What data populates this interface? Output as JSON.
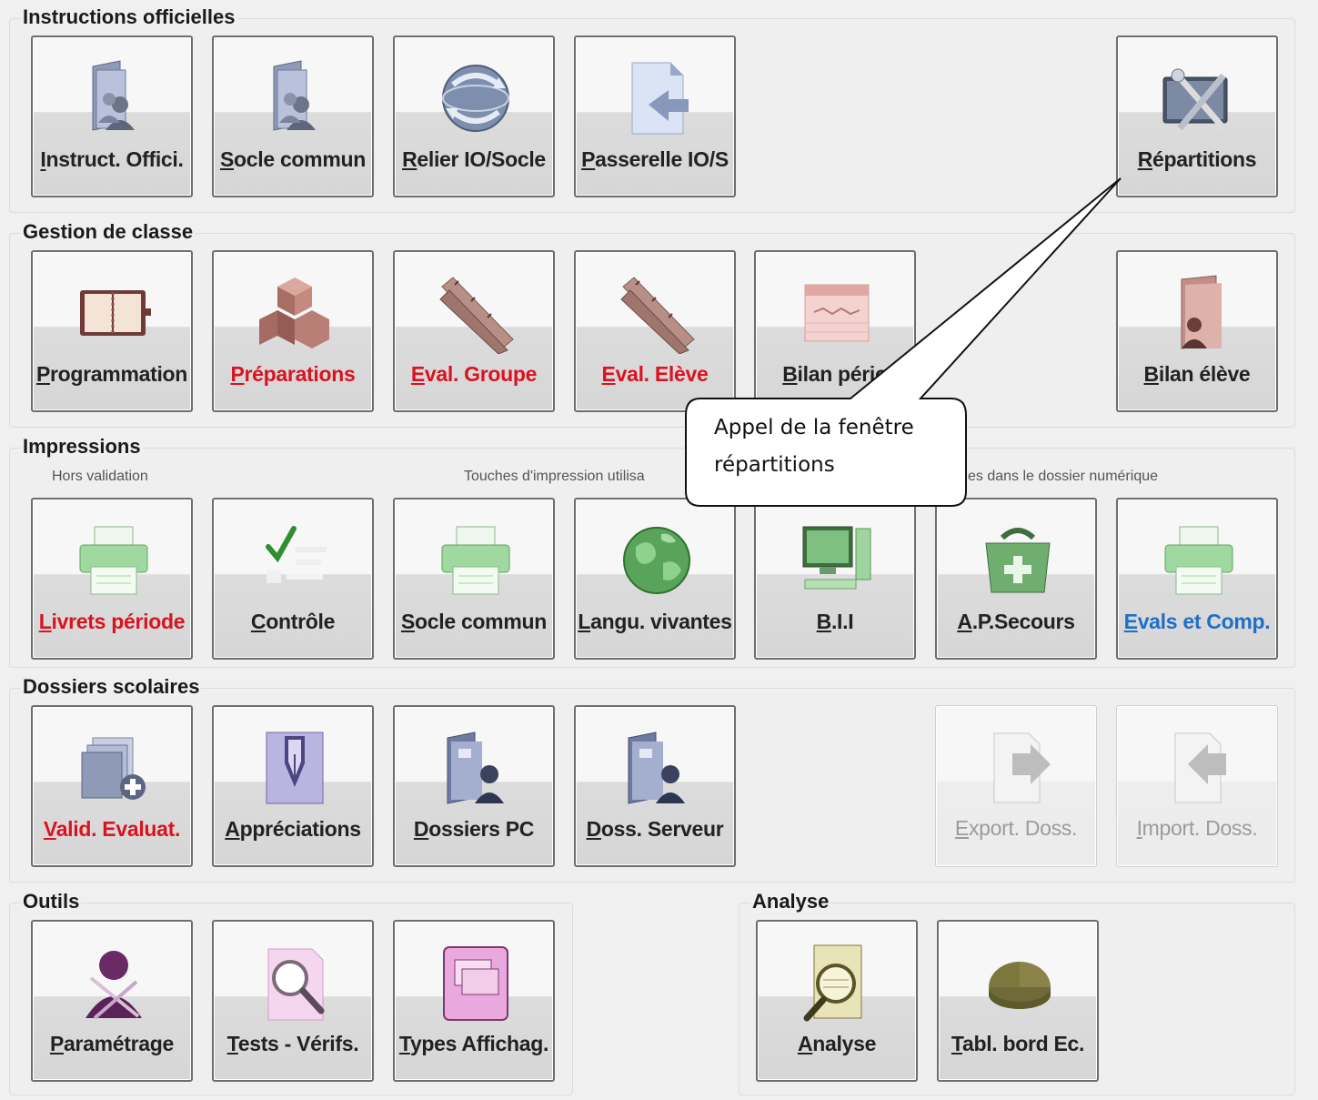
{
  "groups": {
    "instructions": {
      "title": "Instructions officielles",
      "buttons": [
        {
          "label": "Instruct. Offici.",
          "icon": "folder-users-icon"
        },
        {
          "label": "Socle commun",
          "icon": "folder-users-icon"
        },
        {
          "label": "Relier IO/Socle",
          "icon": "globe-sync-icon"
        },
        {
          "label": "Passerelle IO/S",
          "icon": "document-arrow-icon"
        },
        {
          "label": "Répartitions",
          "icon": "tools-icon"
        }
      ]
    },
    "gestion": {
      "title": "Gestion de classe",
      "buttons": [
        {
          "label": "Programmation",
          "icon": "planner-book-icon"
        },
        {
          "label": "Préparations",
          "icon": "cubes-icon"
        },
        {
          "label": "Eval. Groupe",
          "icon": "ruler-icon"
        },
        {
          "label": "Eval. Elève",
          "icon": "ruler-icon"
        },
        {
          "label": "Bilan pério",
          "icon": "calendar-icon"
        },
        {
          "label": "Bilan élève",
          "icon": "folder-person-icon"
        }
      ]
    },
    "impressions": {
      "title": "Impressions",
      "sub_left": "Hors validation",
      "sub_mid": "Touches d'impression utilisa",
      "sub_right": "es dans le dossier numérique",
      "buttons": [
        {
          "label": "Livrets période",
          "icon": "printer-icon"
        },
        {
          "label": "Contrôle",
          "icon": "checkmark-icon"
        },
        {
          "label": "Socle commun",
          "icon": "printer-icon"
        },
        {
          "label": "Langu. vivantes",
          "icon": "globe-icon"
        },
        {
          "label": "B.I.I",
          "icon": "computer-icon"
        },
        {
          "label": "A.P.Secours",
          "icon": "first-aid-bag-icon"
        },
        {
          "label": "Evals et Comp.",
          "icon": "printer-icon"
        }
      ]
    },
    "dossiers": {
      "title": "Dossiers scolaires",
      "buttons": [
        {
          "label": "Valid. Evaluat.",
          "icon": "files-add-icon"
        },
        {
          "label": "Appréciations",
          "icon": "fountain-pen-icon"
        },
        {
          "label": "Dossiers PC",
          "icon": "folder-user-icon"
        },
        {
          "label": "Doss. Serveur",
          "icon": "folder-user-icon"
        },
        {
          "label": "Export. Doss.",
          "icon": "export-arrow-icon"
        },
        {
          "label": "Import. Doss.",
          "icon": "import-arrow-icon"
        }
      ]
    },
    "outils": {
      "title": "Outils",
      "buttons": [
        {
          "label": "Paramétrage",
          "icon": "user-settings-icon"
        },
        {
          "label": "Tests - Vérifs.",
          "icon": "magnifier-icon"
        },
        {
          "label": "Types Affichag.",
          "icon": "display-windows-icon"
        }
      ]
    },
    "analyse": {
      "title": "Analyse",
      "buttons": [
        {
          "label": "Analyse",
          "icon": "document-magnifier-icon"
        },
        {
          "label": "Tabl. bord Ec.",
          "icon": "pie-chart-icon"
        }
      ]
    }
  },
  "callout": {
    "line1": "Appel de la fenêtre",
    "line2": "répartitions"
  },
  "colors": {
    "red_label": "#d9131f",
    "blue_label": "#1e6fc7",
    "disabled_label": "#9b9b9b"
  }
}
